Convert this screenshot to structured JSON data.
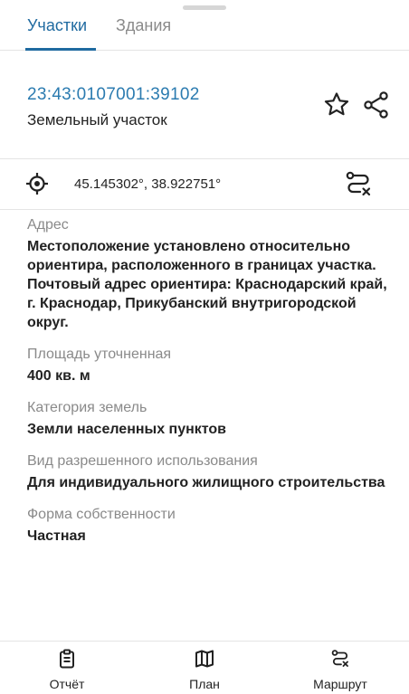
{
  "tabs": [
    {
      "label": "Участки"
    },
    {
      "label": "Здания"
    }
  ],
  "parcel": {
    "cadastral_number": "23:43:0107001:39102",
    "type": "Земельный участок"
  },
  "coordinates": "45.145302°, 38.922751°",
  "properties": [
    {
      "label": "Адрес",
      "value": "Местоположение установлено относительно ориентира, расположенного в границах участка. Почтовый адрес ориентира: Краснодарский край, г. Краснодар, Прикубанский внутригородской округ."
    },
    {
      "label": "Площадь уточненная",
      "value": "400 кв. м"
    },
    {
      "label": "Категория земель",
      "value": "Земли населенных пунктов"
    },
    {
      "label": "Вид разрешенного использования",
      "value": "Для индивидуального жилищного строительства"
    },
    {
      "label": "Форма собственности",
      "value": "Частная"
    }
  ],
  "footer": [
    {
      "label": "Отчёт",
      "icon": "clipboard-icon"
    },
    {
      "label": "План",
      "icon": "map-icon"
    },
    {
      "label": "Маршрут",
      "icon": "route-icon"
    }
  ],
  "colors": {
    "accent": "#1f6aa0",
    "link": "#2b7bb0",
    "muted": "#8a8a8a"
  }
}
